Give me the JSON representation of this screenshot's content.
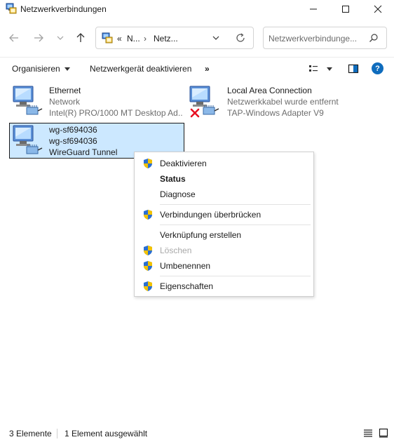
{
  "window": {
    "title": "Netzwerkverbindungen"
  },
  "address": {
    "chevrons": "«",
    "crumb1": "N...",
    "crumb2": "Netz..."
  },
  "search": {
    "placeholder": "Netzwerkverbindunge..."
  },
  "toolbar": {
    "organize": "Organisieren",
    "deactivate": "Netzwerkgerät deaktivieren",
    "more": "»"
  },
  "connections": [
    {
      "name": "Ethernet",
      "status": "Network",
      "device": "Intel(R) PRO/1000 MT Desktop Ad...",
      "disconnected": false,
      "selected": false
    },
    {
      "name": "Local Area Connection",
      "status": "Netzwerkkabel wurde entfernt",
      "device": "TAP-Windows Adapter V9",
      "disconnected": true,
      "selected": false
    },
    {
      "name": "wg-sf694036",
      "status": "wg-sf694036",
      "device": "WireGuard Tunnel",
      "disconnected": false,
      "selected": true
    }
  ],
  "context_menu": {
    "items": [
      {
        "label": "Deaktivieren",
        "shield": true,
        "bold": false,
        "disabled": false
      },
      {
        "label": "Status",
        "shield": false,
        "bold": true,
        "disabled": false
      },
      {
        "label": "Diagnose",
        "shield": false,
        "bold": false,
        "disabled": false
      },
      {
        "label": "Verbindungen überbrücken",
        "shield": true,
        "bold": false,
        "disabled": false
      },
      {
        "label": "Verknüpfung erstellen",
        "shield": false,
        "bold": false,
        "disabled": false
      },
      {
        "label": "Löschen",
        "shield": true,
        "bold": false,
        "disabled": true
      },
      {
        "label": "Umbenennen",
        "shield": true,
        "bold": false,
        "disabled": false
      },
      {
        "label": "Eigenschaften",
        "shield": true,
        "bold": false,
        "disabled": false
      }
    ]
  },
  "statusbar": {
    "count": "3 Elemente",
    "selection": "1 Element ausgewählt"
  },
  "colors": {
    "selection_bg": "#cce8ff",
    "accent": "#0f6cbd",
    "error_x": "#e81123"
  }
}
